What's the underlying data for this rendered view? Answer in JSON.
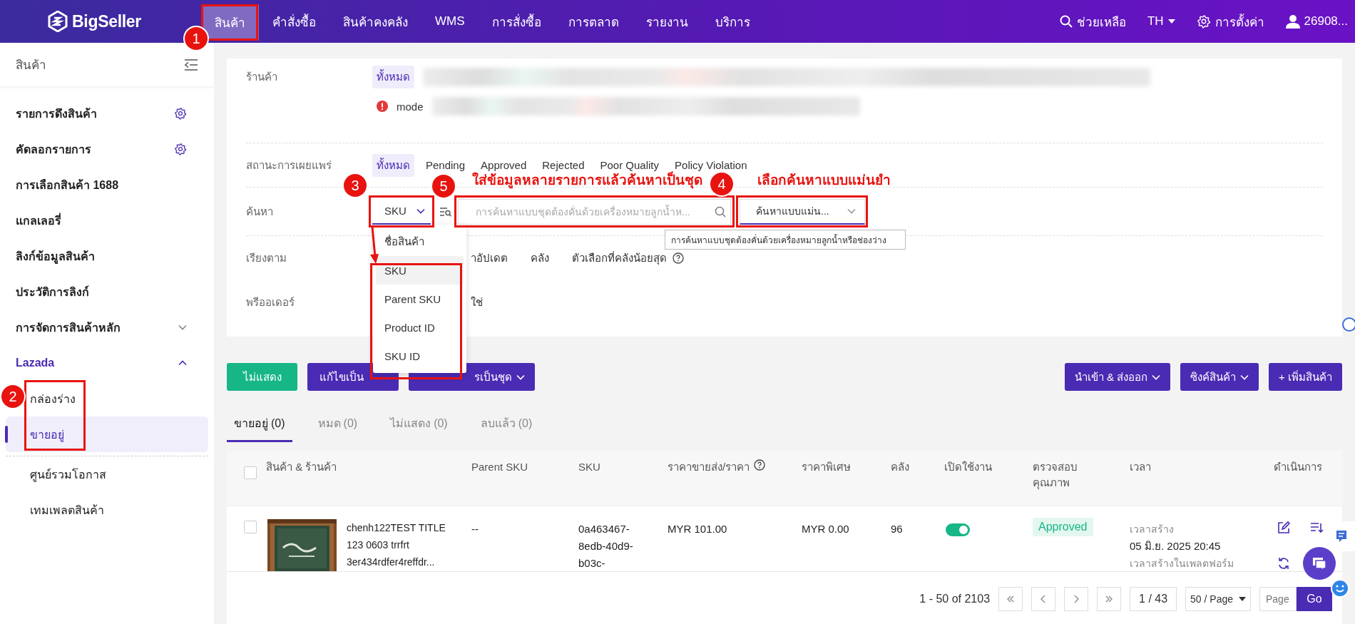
{
  "topbar": {
    "logo": "BigSeller",
    "nav": [
      {
        "label": "สินค้า",
        "selected": true
      },
      {
        "label": "คำสั่งซื้อ",
        "selected": false
      },
      {
        "label": "สินค้าคงคลัง",
        "selected": false
      },
      {
        "label": "WMS",
        "selected": false
      },
      {
        "label": "การสั่งซื้อ",
        "selected": false
      },
      {
        "label": "การตลาด",
        "selected": false
      },
      {
        "label": "รายงาน",
        "selected": false
      },
      {
        "label": "บริการ",
        "selected": false
      }
    ],
    "help": "ช่วยเหลือ",
    "language": "TH",
    "settings": "การตั้งค่า",
    "user": "26908..."
  },
  "sidebar": {
    "title": "สินค้า",
    "items": [
      {
        "label": "รายการดึงสินค้า",
        "kind": "setting"
      },
      {
        "label": "คัดลอกรายการ",
        "kind": "setting"
      },
      {
        "label": "การเลือกสินค้า 1688",
        "kind": "link"
      },
      {
        "label": "แกลเลอรี่",
        "kind": "link"
      },
      {
        "label": "ลิงก์ข้อมูลสินค้า",
        "kind": "link"
      },
      {
        "label": "ประวัติการลิงก์",
        "kind": "link"
      },
      {
        "label": "การจัดการสินค้าหลัก",
        "kind": "group",
        "expanded": false
      },
      {
        "label": "Lazada",
        "kind": "group",
        "expanded": true,
        "children": [
          {
            "label": "กล่องร่าง",
            "selected": false
          },
          {
            "label": "ขายอยู่",
            "selected": true
          },
          {
            "label": "ศูนย์รวมโอกาส",
            "selected": false
          },
          {
            "label": "เทมเพลตสินค้า",
            "selected": false
          }
        ]
      }
    ]
  },
  "filters": {
    "store": {
      "label": "ร้านค้า",
      "all": {
        "label": "ทั้งหมด",
        "selected": true
      },
      "warning": "mode"
    },
    "status": {
      "label": "สถานะการเผยแพร่",
      "options": [
        {
          "label": "ทั้งหมด",
          "selected": true
        },
        {
          "label": "Pending",
          "selected": false
        },
        {
          "label": "Approved",
          "selected": false
        },
        {
          "label": "Rejected",
          "selected": false
        },
        {
          "label": "Poor Quality",
          "selected": false
        },
        {
          "label": "Policy Violation",
          "selected": false
        }
      ]
    },
    "search": {
      "label": "ค้นหา",
      "field": "SKU",
      "placeholder": "การค้นหาแบบชุดต้องคั่นด้วยเครื่องหมายลูกน้ำห...",
      "match": "ค้นหาแบบแม่น...",
      "tooltip": "การค้นหาแบบชุดต้องคั่นด้วยเครื่องหมายลูกน้ำหรือช่องว่าง",
      "menu": [
        {
          "label": "ชื่อสินค้า",
          "selected": false
        },
        {
          "label": "SKU",
          "selected": true
        },
        {
          "label": "Parent SKU",
          "selected": false
        },
        {
          "label": "Product ID",
          "selected": false
        },
        {
          "label": "SKU ID",
          "selected": false
        }
      ]
    },
    "sort": {
      "label": "เรียงตาม",
      "options": [
        {
          "label": "าอัปเดต",
          "help": false
        },
        {
          "label": "คลัง",
          "help": false
        },
        {
          "label": "ตัวเลือกที่คลังน้อยสุด",
          "help": true
        }
      ]
    },
    "preorder": {
      "label": "พรีออเดอร์",
      "options": [
        {
          "label": "ใช่"
        }
      ]
    }
  },
  "actions": {
    "left": [
      {
        "label": "ไม่แสดง",
        "kind": "green",
        "caret": false
      },
      {
        "label": "แก้ไขเป็น",
        "kind": "purple",
        "caret": false
      },
      {
        "label": "รเป็นชุด",
        "kind": "purple",
        "caret": true
      }
    ],
    "right": [
      {
        "label": "นำเข้า & ส่งออก",
        "kind": "purple",
        "caret": true
      },
      {
        "label": "ซิงค์สินค้า",
        "kind": "purple",
        "caret": true
      },
      {
        "label": "+ เพิ่มสินค้า",
        "kind": "purple",
        "caret": false
      }
    ]
  },
  "tabs": [
    {
      "label": "ขายอยู่",
      "count": "(0)",
      "selected": true
    },
    {
      "label": "หมด",
      "count": "(0)",
      "selected": false
    },
    {
      "label": "ไม่แสดง",
      "count": "(0)",
      "selected": false
    },
    {
      "label": "ลบแล้ว",
      "count": "(0)",
      "selected": false
    }
  ],
  "table": {
    "select_all": false,
    "columns": [
      {
        "label": "สินค้า & ร้านค้า",
        "help": false
      },
      {
        "label": "Parent SKU",
        "help": false
      },
      {
        "label": "SKU",
        "help": false
      },
      {
        "label": "ราคาขายส่ง/ราคา",
        "help": true
      },
      {
        "label": "ราคาพิเศษ",
        "help": false
      },
      {
        "label": "คลัง",
        "help": false
      },
      {
        "label": "เปิดใช้งาน",
        "help": false
      },
      {
        "label": "ตรวจสอบ คุณภาพ",
        "help": false
      },
      {
        "label": "เวลา",
        "help": false
      },
      {
        "label": "ดำเนินการ",
        "help": false
      }
    ],
    "rows": [
      {
        "checked": false,
        "title": "chenh122TEST TITLE 123 0603 trrfrt 3er434rdfer4reffdr...",
        "parent_sku": "--",
        "sku": "0a463467-8edb-40d9-b03c-",
        "price": "MYR 101.00",
        "special_price": "MYR 0.00",
        "stock": "96",
        "enabled": true,
        "quality": "Approved",
        "created_label": "เวลาสร้าง",
        "created": "05 มิ.ย. 2025 20:45",
        "platform_label": "เวลาสร้างในเพลตฟอร์ม"
      }
    ]
  },
  "pagination": {
    "range": "1 - 50 of 2103",
    "page": "1 / 43",
    "page_size": "50 / Page",
    "goto_placeholder": "Page",
    "go": "Go"
  },
  "annotations": {
    "markers": [
      "1",
      "2",
      "3",
      "5",
      "4"
    ],
    "notes": [
      "ใส่ข้อมูลหลายรายการแล้วค้นหาเป็นชุด",
      "เลือกค้นหาแบบแม่นยำ"
    ]
  }
}
